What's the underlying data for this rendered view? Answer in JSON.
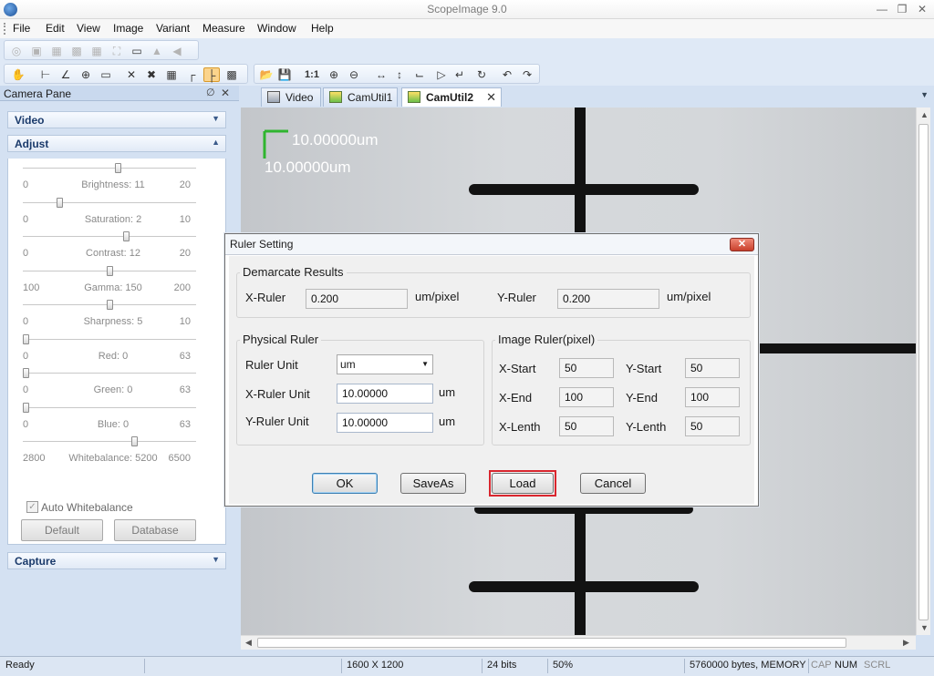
{
  "app": {
    "title": "ScopeImage 9.0"
  },
  "menu": [
    "File",
    "Edit",
    "View",
    "Image",
    "Variant",
    "Measure",
    "Window",
    "Help"
  ],
  "pane": {
    "title": "Camera Pane",
    "sections": {
      "video": "Video",
      "adjust": "Adjust",
      "capture": "Capture"
    },
    "sliders": [
      {
        "name": "Brightness",
        "label": "Brightness: 11",
        "min": "0",
        "max": "20",
        "value": 11,
        "low": 0,
        "high": 20
      },
      {
        "name": "Saturation",
        "label": "Saturation: 2",
        "min": "0",
        "max": "10",
        "value": 2,
        "low": 0,
        "high": 10
      },
      {
        "name": "Contrast",
        "label": "Contrast: 12",
        "min": "0",
        "max": "20",
        "value": 12,
        "low": 0,
        "high": 20
      },
      {
        "name": "Gamma",
        "label": "Gamma: 150",
        "min": "100",
        "max": "200",
        "value": 150,
        "low": 100,
        "high": 200
      },
      {
        "name": "Sharpness",
        "label": "Sharpness: 5",
        "min": "0",
        "max": "10",
        "value": 5,
        "low": 0,
        "high": 10
      },
      {
        "name": "Red",
        "label": "Red: 0",
        "min": "0",
        "max": "63",
        "value": 0,
        "low": 0,
        "high": 63
      },
      {
        "name": "Green",
        "label": "Green: 0",
        "min": "0",
        "max": "63",
        "value": 0,
        "low": 0,
        "high": 63
      },
      {
        "name": "Blue",
        "label": "Blue: 0",
        "min": "0",
        "max": "63",
        "value": 0,
        "low": 0,
        "high": 63
      },
      {
        "name": "Whitebalance",
        "label": "Whitebalance: 5200",
        "min": "2800",
        "max": "6500",
        "value": 5200,
        "low": 2800,
        "high": 6500
      }
    ],
    "auto_whitebalance": "Auto Whitebalance",
    "buttons": {
      "default": "Default",
      "database": "Database"
    }
  },
  "tabs": [
    "Video",
    "CamUtil1",
    "CamUtil2"
  ],
  "viewer": {
    "scale_x": "10.00000um",
    "scale_y": "10.00000um"
  },
  "dialog": {
    "title": "Ruler Setting",
    "demarcate": {
      "group": "Demarcate Results",
      "x_label": "X-Ruler",
      "x_value": "0.200",
      "x_unit": "um/pixel",
      "y_label": "Y-Ruler",
      "y_value": "0.200",
      "y_unit": "um/pixel"
    },
    "physical": {
      "group": "Physical Ruler",
      "unit_label": "Ruler Unit",
      "unit_value": "um",
      "x_label": "X-Ruler Unit",
      "x_value": "10.00000",
      "x_unit": "um",
      "y_label": "Y-Ruler Unit",
      "y_value": "10.00000",
      "y_unit": "um"
    },
    "image": {
      "group": "Image Ruler(pixel)",
      "x_start_label": "X-Start",
      "x_start": "50",
      "y_start_label": "Y-Start",
      "y_start": "50",
      "x_end_label": "X-End",
      "x_end": "100",
      "y_end_label": "Y-End",
      "y_end": "100",
      "x_len_label": "X-Lenth",
      "x_len": "50",
      "y_len_label": "Y-Lenth",
      "y_len": "50"
    },
    "buttons": {
      "ok": "OK",
      "saveas": "SaveAs",
      "load": "Load",
      "cancel": "Cancel"
    },
    "highlight_color": "#d9262e"
  },
  "status": {
    "ready": "Ready",
    "size": "1600 X 1200",
    "bits": "24 bits",
    "zoom": "50%",
    "memory": "5760000 bytes, MEMORY",
    "cap": "CAP",
    "num": "NUM",
    "scrl": "SCRL"
  }
}
